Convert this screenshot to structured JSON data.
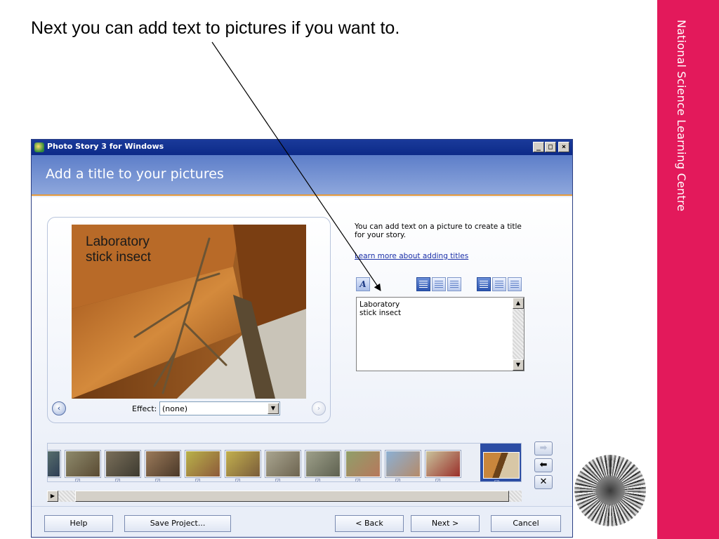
{
  "slide": {
    "caption": "Next you can add text to pictures if you want to.",
    "brand": "National Science Learning Centre"
  },
  "window": {
    "title": "Photo Story 3 for Windows",
    "controls": {
      "minimize": "_",
      "maximize": "□",
      "close": "×"
    }
  },
  "header": {
    "title": "Add a title to your pictures"
  },
  "preview": {
    "overlay_text": "Laboratory\nstick insect",
    "effect_label": "Effect:",
    "effect_value": "(none)",
    "prev_icon": "‹",
    "next_icon": "›"
  },
  "help_panel": {
    "instructions": "You can add text on a picture to create a title for your story.",
    "link": "Learn more about adding titles",
    "font_button": "A",
    "text_value": "Laboratory\nstick insect"
  },
  "filmstrip": {
    "edit_icon": "☑",
    "thumbnails": [
      {
        "c1": "#6f8a78",
        "c2": "#2e3e56"
      },
      {
        "c1": "#8e8a6c",
        "c2": "#5a4b33"
      },
      {
        "c1": "#7a6f5a",
        "c2": "#3d3a30"
      },
      {
        "c1": "#9b7a5a",
        "c2": "#4a3828"
      },
      {
        "c1": "#b9b24a",
        "c2": "#8d5a3a"
      },
      {
        "c1": "#c2b04e",
        "c2": "#7a5c3a"
      },
      {
        "c1": "#a9a590",
        "c2": "#6d6450"
      },
      {
        "c1": "#9ea08a",
        "c2": "#5e6150"
      },
      {
        "c1": "#8f9f6a",
        "c2": "#b7785c"
      },
      {
        "c1": "#8cb0d4",
        "c2": "#b58b6a"
      },
      {
        "c1": "#c9c39c",
        "c2": "#9a2f2a"
      }
    ],
    "side_buttons": {
      "forward": "➡",
      "back": "⬅",
      "remove": "✕"
    }
  },
  "footer": {
    "help": "Help",
    "save": "Save Project...",
    "back": "< Back",
    "next": "Next >",
    "cancel": "Cancel"
  },
  "colors": {
    "brand": "#e3195b",
    "header_blue": "#5d7ec9",
    "titlebar_blue": "#0c2a88"
  }
}
